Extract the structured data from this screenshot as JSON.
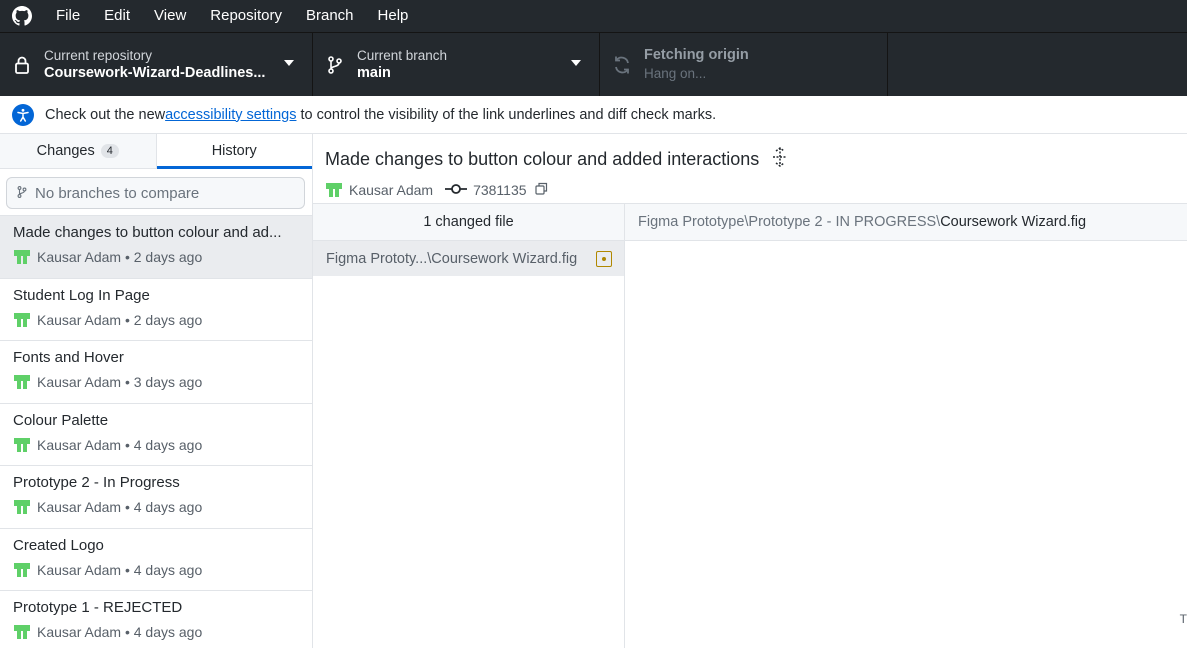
{
  "menu": {
    "items": [
      "File",
      "Edit",
      "View",
      "Repository",
      "Branch",
      "Help"
    ]
  },
  "toolbar": {
    "repo_label": "Current repository",
    "repo_value": "Coursework-Wizard-Deadlines...",
    "branch_label": "Current branch",
    "branch_value": "main",
    "fetch_label": "Fetching origin",
    "fetch_value": "Hang on..."
  },
  "notice": {
    "before": "Check out the new ",
    "link": "accessibility settings",
    "after": " to control the visibility of the link underlines and diff check marks."
  },
  "tabs": {
    "changes_label": "Changes",
    "changes_count": "4",
    "history_label": "History"
  },
  "compare": {
    "placeholder": "No branches to compare"
  },
  "commits": [
    {
      "title": "Made changes to button colour and ad...",
      "author": "Kausar Adam",
      "time": "2 days ago"
    },
    {
      "title": "Student Log In Page",
      "author": "Kausar Adam",
      "time": "2 days ago"
    },
    {
      "title": "Fonts and Hover",
      "author": "Kausar Adam",
      "time": "3 days ago"
    },
    {
      "title": "Colour Palette",
      "author": "Kausar Adam",
      "time": "4 days ago"
    },
    {
      "title": "Prototype 2 - In Progress",
      "author": "Kausar Adam",
      "time": "4 days ago"
    },
    {
      "title": "Created Logo",
      "author": "Kausar Adam",
      "time": "4 days ago"
    },
    {
      "title": "Prototype 1 - REJECTED",
      "author": "Kausar Adam",
      "time": "4 days ago"
    }
  ],
  "commit_detail": {
    "title": "Made changes to button colour and added interactions",
    "author": "Kausar Adam",
    "sha": "7381135",
    "files_header": "1 changed file",
    "file_row": "Figma Prototy...\\Coursework Wizard.fig",
    "diff_path": "Figma Prototype\\Prototype 2 - IN PROGRESS\\",
    "diff_file": "Coursework Wizard.fig",
    "corner_text": "T"
  },
  "colors": {
    "menubar_bg": "#24292e",
    "accent": "#0366d6",
    "modified": "#b08800",
    "avatar_green": "#5fd068"
  }
}
